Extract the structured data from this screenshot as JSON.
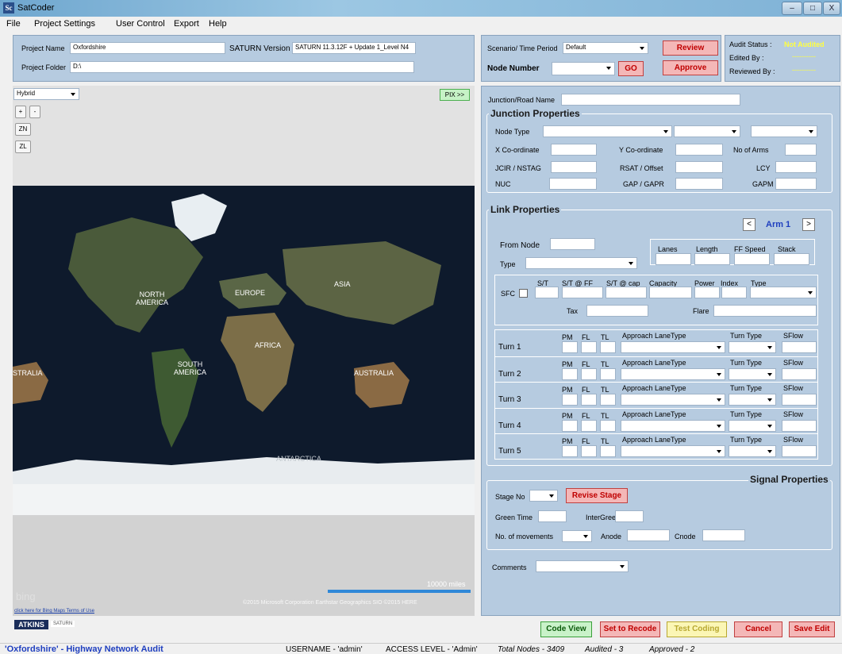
{
  "window": {
    "title": "SatCoder",
    "icon": "Sc",
    "minimize": "–",
    "maximize": "□",
    "close": "X"
  },
  "menu": [
    "File",
    "Project Settings",
    "User Control",
    "Export",
    "Help"
  ],
  "project": {
    "name_label": "Project Name",
    "name_value": "Oxfordshire",
    "saturn_label": "SATURN Version",
    "saturn_value": "SATURN 11.3.12F + Update 1_Level N4",
    "folder_label": "Project Folder",
    "folder_value": "D:\\"
  },
  "scenario": {
    "label": "Scenario/ Time Period",
    "value": "Default",
    "node_label": "Node Number",
    "node_value": "",
    "go": "GO",
    "review": "Review",
    "approve": "Approve"
  },
  "audit": {
    "status_label": "Audit Status :",
    "status_value": "Not Audited",
    "edited_label": "Edited By :",
    "edited_value": "----------",
    "reviewed_label": "Reviewed By :",
    "reviewed_value": "----------"
  },
  "map": {
    "view": "Hybrid",
    "pix": "PIX >>",
    "plus": "+",
    "minus": "-",
    "zn": "ZN",
    "zl": "ZL",
    "labels": {
      "na": "NORTH\nAMERICA",
      "eu": "EUROPE",
      "asia": "ASIA",
      "africa": "AFRICA",
      "sa": "SOUTH\nAMERICA",
      "au": "AUSTRALIA",
      "au2": "STRALIA",
      "ant": "ANTARCTICA"
    },
    "scale": "10000 miles",
    "bing": "bing",
    "copyright": "©2015 Microsoft Corporation   Earthstar Geographics  SIO   ©2015 HERE",
    "terms": "click here for Bing Maps Terms of Use"
  },
  "logos": {
    "atkins": "ATKINS",
    "saturn": "SATURN"
  },
  "junction": {
    "road_label": "Junction/Road Name",
    "road_value": "",
    "title": "Junction Properties",
    "node_type": "Node Type",
    "x": "X  Co-ordinate",
    "y": "Y  Co-ordinate",
    "arms": "No of Arms",
    "jcir": "JCIR / NSTAG",
    "rsat": "RSAT / Offset",
    "lcy": "LCY",
    "nuc": "NUC",
    "gap": "GAP / GAPR",
    "gapm": "GAPM"
  },
  "link": {
    "title": "Link Properties",
    "prev": "<",
    "arm": "Arm 1",
    "next": ">",
    "from_node": "From Node",
    "type": "Type",
    "lanes": "Lanes",
    "length": "Length",
    "ff_speed": "FF Speed",
    "stack": "Stack",
    "sfc": "SFC",
    "st": "S/T",
    "st_ff": "S/T @ FF",
    "st_cap": "S/T @ cap",
    "capacity": "Capacity",
    "power": "Power",
    "index": "Index",
    "type2": "Type",
    "tax": "Tax",
    "flare": "Flare"
  },
  "turns": [
    {
      "name": "Turn 1"
    },
    {
      "name": "Turn 2"
    },
    {
      "name": "Turn 3"
    },
    {
      "name": "Turn 4"
    },
    {
      "name": "Turn 5"
    }
  ],
  "turn_headers": {
    "pm": "PM",
    "fl": "FL",
    "tl": "TL",
    "approach": "Approach LaneType",
    "turn_type": "Turn Type",
    "sflow": "SFlow"
  },
  "signal": {
    "title": "Signal Properties",
    "stage_no": "Stage No",
    "revise": "Revise Stage",
    "green": "Green Time",
    "intergreen": "InterGreen",
    "movements": "No. of movements",
    "anode": "Anode",
    "cnode": "Cnode"
  },
  "comments": {
    "label": "Comments"
  },
  "bottom": {
    "code_view": "Code View",
    "set_recode": "Set to Recode",
    "test_coding": "Test Coding",
    "cancel": "Cancel",
    "save_edit": "Save Edit"
  },
  "status": {
    "project": "'Oxfordshire' - Highway Network Audit",
    "user": "USERNAME - 'admin'",
    "access": "ACCESS LEVEL - 'Admin'",
    "total": "Total Nodes - 3409",
    "audited": "Audited - 3",
    "approved": "Approved - 2"
  }
}
